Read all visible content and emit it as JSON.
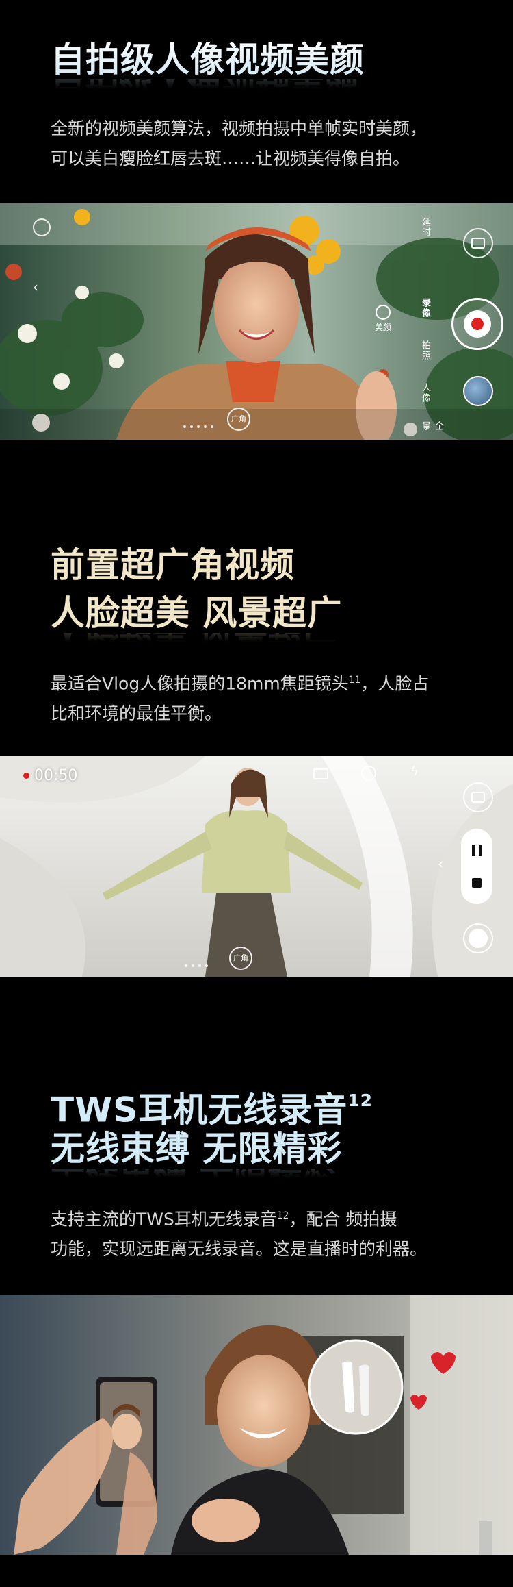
{
  "section1": {
    "title": "自拍级人像视频美颜",
    "desc_line1": "全新的视频美颜算法，视频拍摄中单帧实时美颜，",
    "desc_line2": "可以美白瘦脸红唇去斑……让视频美得像自拍。",
    "camera_ui": {
      "beauty_label": "美颜",
      "wide_label": "广角",
      "modes": [
        "延时",
        "录像",
        "拍照",
        "人像",
        "全景"
      ]
    }
  },
  "section2": {
    "title_line1": "前置超广角视频",
    "title_line2": "人脸超美 风景超广",
    "desc_line1_pre": "最适合Vlog人像拍摄的18mm焦距镜头",
    "desc_line1_sup": "11",
    "desc_line1_post": "，人脸占",
    "desc_line2": "比和环境的最佳平衡。",
    "video_ui": {
      "timer": "00:50",
      "wide_label": "广角"
    }
  },
  "section3": {
    "title_line1_pre": "TWS耳机无线录音",
    "title_line1_sup": "12",
    "title_line2": "无线束缚 无限精彩",
    "desc_line1_pre": "支持主流的TWS耳机无线录音",
    "desc_line1_sup": "12",
    "desc_line1_post": "，配合 频拍摄",
    "desc_line2": "功能，实现远距离无线录音。这是直播时的利器。"
  },
  "colors": {
    "background": "#000000",
    "title_gradient_start": "#ffffff",
    "title_gradient_end": "#e8dcc0",
    "record_red": "#e0201f"
  }
}
